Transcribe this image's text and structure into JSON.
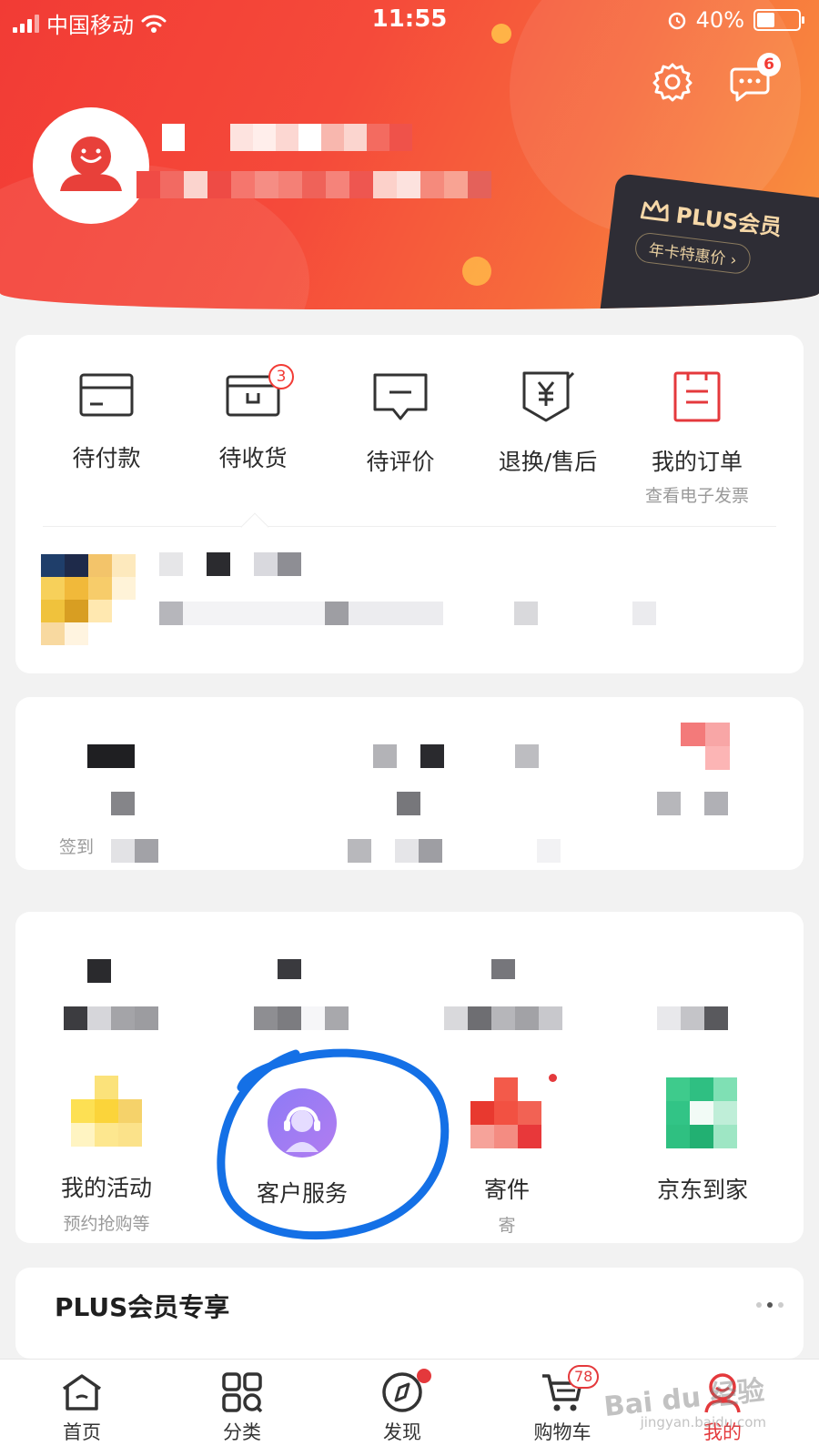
{
  "status_bar": {
    "carrier": "中国移动",
    "time": "11:55",
    "battery_pct": "40%"
  },
  "header": {
    "message_badge": "6"
  },
  "plus_promo": {
    "title": "PLUS会员",
    "subtitle": "年卡特惠价 ›"
  },
  "orders": {
    "items": [
      {
        "label": "待付款",
        "icon": "wallet-card-icon"
      },
      {
        "label": "待收货",
        "icon": "package-box-icon",
        "badge": "3"
      },
      {
        "label": "待评价",
        "icon": "comment-bubble-icon"
      },
      {
        "label": "退换/售后",
        "icon": "yen-shield-icon"
      },
      {
        "label": "我的订单",
        "sub": "查看电子发票",
        "icon": "order-list-icon"
      }
    ],
    "tracking_text": "您的订单已..."
  },
  "services": {
    "row1": [
      {
        "label": "签到"
      }
    ],
    "row2": [
      {
        "label": "我的活动",
        "sub": "预约抢购等"
      },
      {
        "label": "客户服务"
      },
      {
        "label": "寄件",
        "sub": "寄"
      },
      {
        "label": "京东到家"
      }
    ]
  },
  "plus_section": {
    "title": "PLUS会员专享"
  },
  "tabbar": {
    "tabs": [
      {
        "label": "首页"
      },
      {
        "label": "分类"
      },
      {
        "label": "发现"
      },
      {
        "label": "购物车",
        "badge": "78"
      },
      {
        "label": "我的"
      }
    ]
  },
  "watermark": {
    "text": "Bai du 经验",
    "sub": "jingyan.baidu.com"
  },
  "colors": {
    "brand_red": "#f23b35",
    "plus_gold": "#f6d8a8",
    "plus_dark": "#2e2d35",
    "annotation_blue": "#1470e6"
  }
}
